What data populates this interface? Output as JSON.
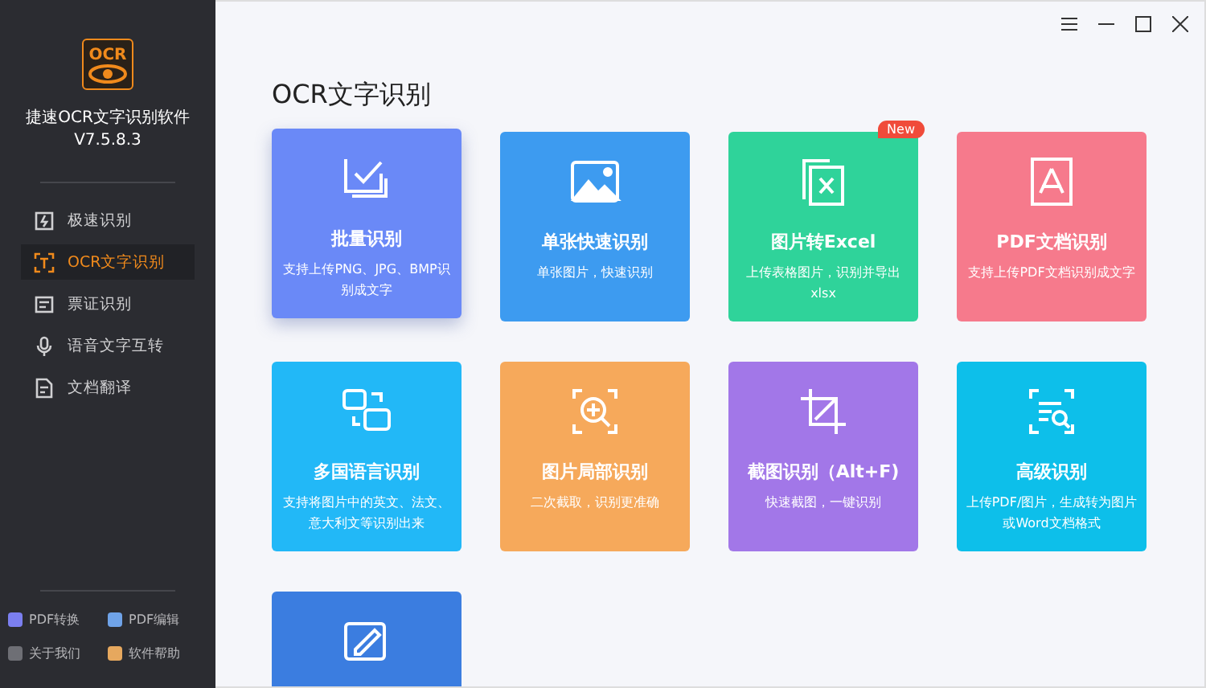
{
  "app": {
    "name": "捷速OCR文字识别软件",
    "version": "V7.5.8.3",
    "logo_text": "OCR"
  },
  "nav": [
    {
      "label": "极速识别",
      "selected": false
    },
    {
      "label": "OCR文字识别",
      "selected": true
    },
    {
      "label": "票证识别",
      "selected": false
    },
    {
      "label": "语音文字互转",
      "selected": false
    },
    {
      "label": "文档翻译",
      "selected": false
    }
  ],
  "footer_links": [
    {
      "label": "PDF转换",
      "color": "#7b7ff0"
    },
    {
      "label": "PDF编辑",
      "color": "#6fa3e8"
    },
    {
      "label": "关于我们",
      "color": "#6e6f75"
    },
    {
      "label": "软件帮助",
      "color": "#e6a85e"
    }
  ],
  "page_title": "OCR文字识别",
  "cards": [
    {
      "title": "批量识别",
      "desc": "支持上传PNG、JPG、BMP识别成文字",
      "color": "#6a89f7",
      "selected": true
    },
    {
      "title": "单张快速识别",
      "desc": "单张图片，快速识别",
      "color": "#3d9bf0",
      "selected": false
    },
    {
      "title": "图片转Excel",
      "desc": "上传表格图片，识别并导出xlsx",
      "color": "#2fd39a",
      "selected": false,
      "badge": "New"
    },
    {
      "title": "PDF文档识别",
      "desc": "支持上传PDF文档识别成文字",
      "color": "#f67a8c",
      "selected": false
    },
    {
      "title": "多国语言识别",
      "desc": "支持将图片中的英文、法文、意大利文等识别出来",
      "color": "#22b8f7",
      "selected": false
    },
    {
      "title": "图片局部识别",
      "desc": "二次截取，识别更准确",
      "color": "#f6a95b",
      "selected": false
    },
    {
      "title": "截图识别（Alt+F)",
      "desc": "快速截图，一键识别",
      "color": "#a277e8",
      "selected": false
    },
    {
      "title": "高级识别",
      "desc": "上传PDF/图片，生成转为图片或Word文档格式",
      "color": "#0dbfea",
      "selected": false
    },
    {
      "color": "#3b7de0",
      "selected": false
    }
  ]
}
